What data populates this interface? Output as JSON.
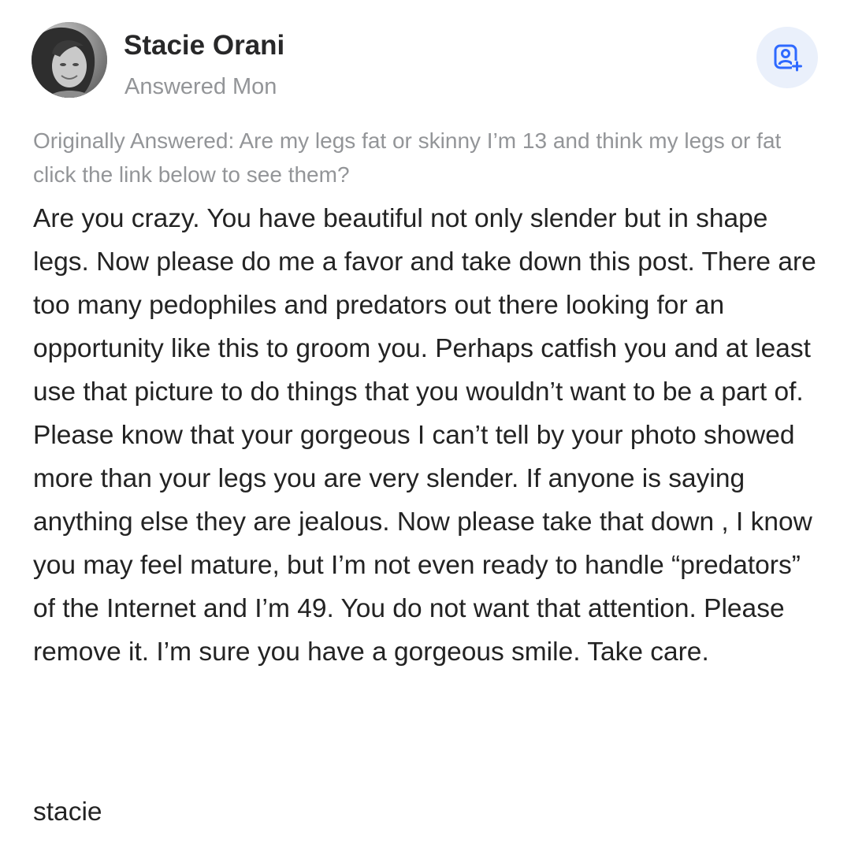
{
  "author": {
    "name": "Stacie Orani",
    "answered_label": "Answered Mon"
  },
  "follow_button_icon": "add-person-icon",
  "accent_color": "#2e69ff",
  "original_question": "Originally Answered: Are my legs fat or skinny I’m 13 and think my legs or fat click the link below to see them?",
  "answer": {
    "body": "Are you crazy. You have beautiful not only slender but in shape legs. Now please do me a favor and take down this post. There are too many pedophiles and predators out there looking for an opportunity like this to groom you. Perhaps catfish you and at least use that picture to do things that you wouldn’t want to be a part of. Please know that your gorgeous I can’t tell by your photo showed more than your legs you are very slender. If anyone is saying anything else they are jealous. Now please take that down , I know you may feel mature, but I’m not even ready to handle “predators” of the Internet and I’m 49. You do not want that attention. Please remove it. I’m sure you have a gorgeous smile. Take care.",
    "signoff": "stacie"
  }
}
